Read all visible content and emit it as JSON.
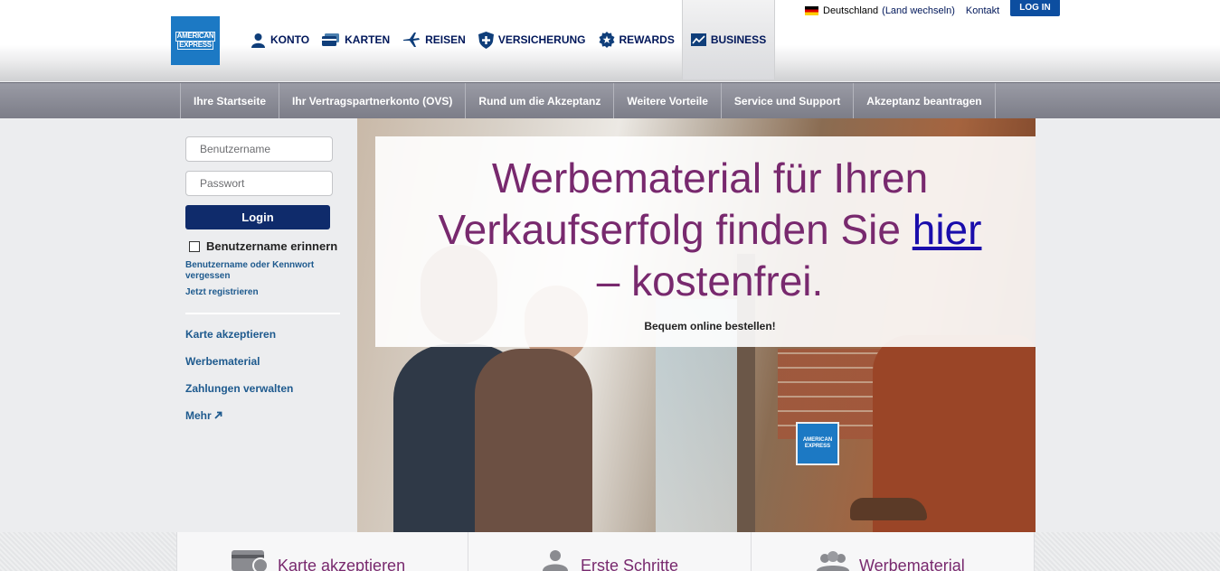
{
  "brand": {
    "logo_line1": "AMERICAN",
    "logo_line2": "EXPRESS",
    "color": "#1c79c4"
  },
  "utility": {
    "country": "Deutschland",
    "change": "(Land wechseln)",
    "contact": "Kontakt",
    "login": "LOG IN"
  },
  "mainnav": [
    {
      "label": "KONTO",
      "icon": "user-icon"
    },
    {
      "label": "KARTEN",
      "icon": "cards-icon"
    },
    {
      "label": "REISEN",
      "icon": "airplane-icon"
    },
    {
      "label": "VERSICHERUNG",
      "icon": "shield-plus-icon"
    },
    {
      "label": "REWARDS",
      "icon": "star-badge-icon"
    },
    {
      "label": "BUSINESS",
      "icon": "chart-icon"
    }
  ],
  "subnav": [
    "Ihre Startseite",
    "Ihr Vertragspartnerkonto (OVS)",
    "Rund um die Akzeptanz",
    "Weitere Vorteile",
    "Service und Support",
    "Akzeptanz beantragen"
  ],
  "login": {
    "username_placeholder": "Benutzername",
    "password_placeholder": "Passwort",
    "button": "Login",
    "remember": "Benutzername erinnern",
    "forgot": "Benutzername oder Kennwort vergessen",
    "register": "Jetzt registrieren"
  },
  "sidemenu": [
    "Karte akzeptieren",
    "Werbematerial",
    "Zahlungen verwalten",
    "Mehr"
  ],
  "hero": {
    "line1": "Werbematerial für Ihren",
    "line2": "Verkaufserfolg finden Sie",
    "link": "hier",
    "line3": "– kostenfrei.",
    "sub": "Bequem online bestellen!",
    "headline_color": "#78296e",
    "sign_line1": "AMERICAN",
    "sign_line2": "EXPRESS"
  },
  "tiles": [
    {
      "label": "Karte akzeptieren",
      "icon": "card-check-icon"
    },
    {
      "label": "Erste Schritte",
      "icon": "person-icon"
    },
    {
      "label": "Werbematerial",
      "icon": "group-icon"
    }
  ]
}
